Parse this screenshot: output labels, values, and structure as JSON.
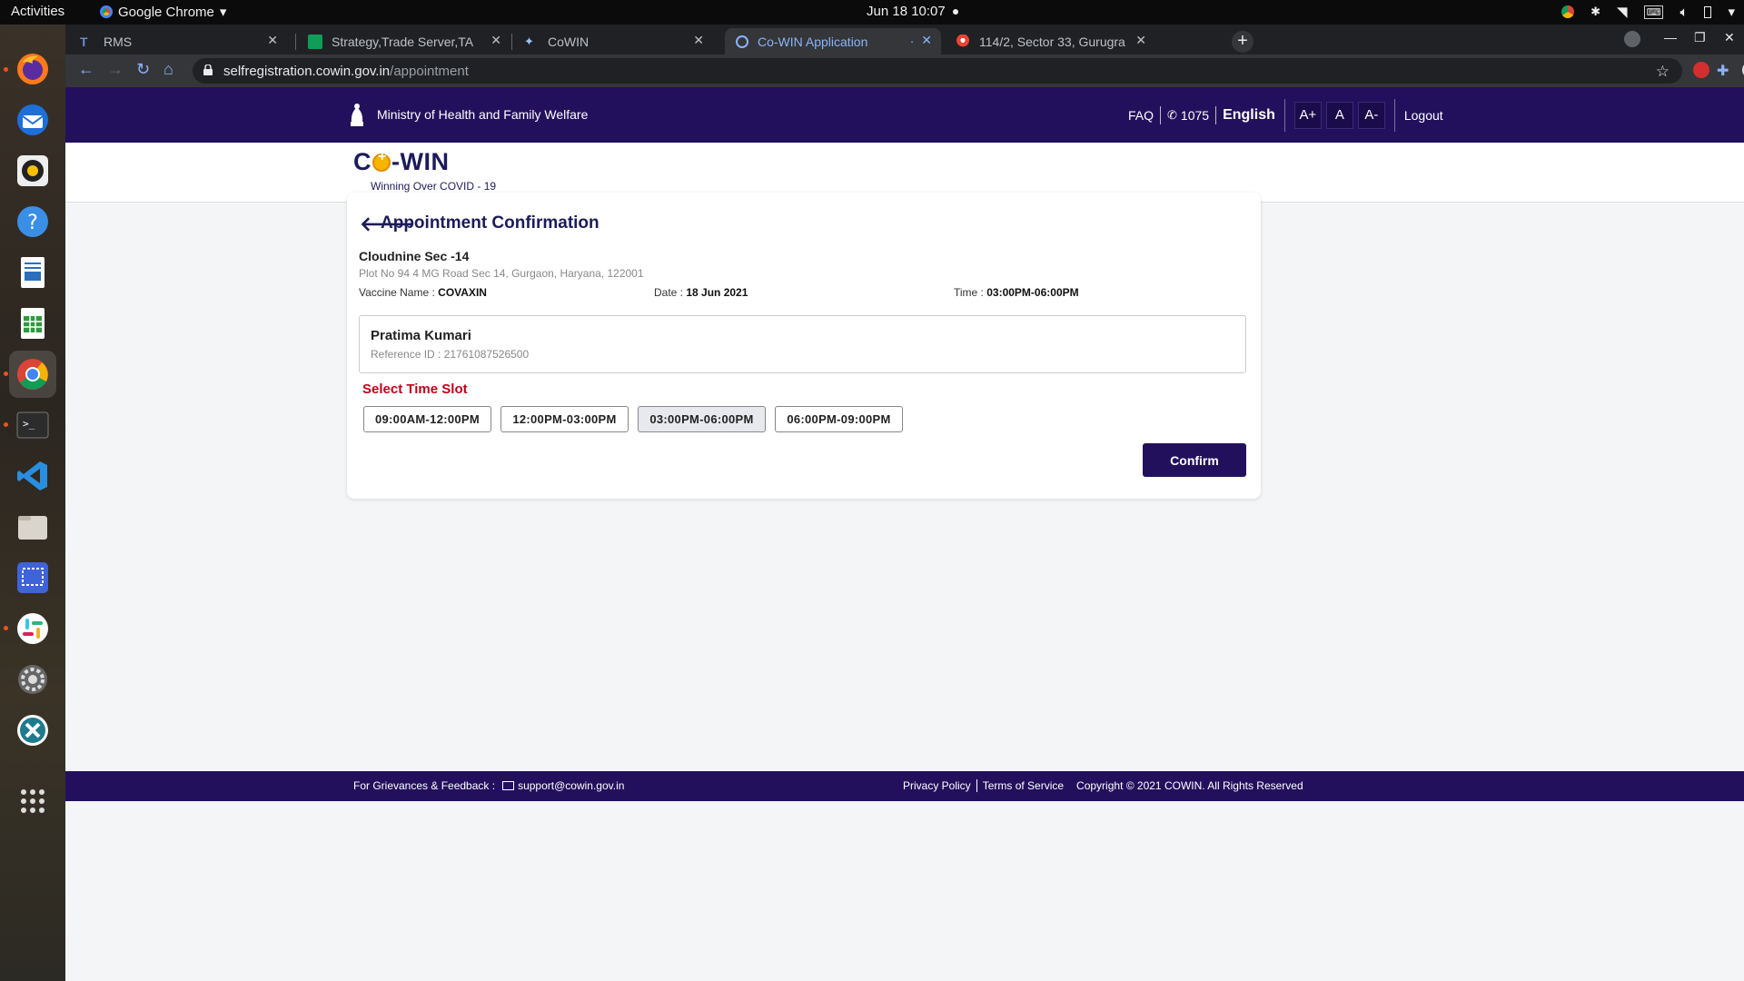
{
  "system": {
    "activities": "Activities",
    "app_name": "Google Chrome",
    "clock": "Jun 18  10:07"
  },
  "tabs": [
    {
      "label": "RMS",
      "active": false
    },
    {
      "label": "Strategy,Trade Server,TA",
      "active": false
    },
    {
      "label": "CoWIN",
      "active": false
    },
    {
      "label": "Co-WIN Application",
      "active": true
    },
    {
      "label": "114/2, Sector 33, Gurugra",
      "active": false
    }
  ],
  "url": {
    "host": "selfregistration.cowin.gov.in",
    "path": "/appointment"
  },
  "header": {
    "ministry": "Ministry of Health and Family Welfare",
    "faq": "FAQ",
    "helpline": "1075",
    "language": "English",
    "font_increase": "A+",
    "font_normal": "A",
    "font_decrease": "A-",
    "logout": "Logout"
  },
  "brand": {
    "logo_left": "C",
    "logo_right": "-WIN",
    "tagline": "Winning Over COVID - 19"
  },
  "appointment": {
    "title": "Appointment Confirmation",
    "center_name": "Cloudnine Sec -14",
    "center_address": "Plot No 94 4 MG Road Sec 14, Gurgaon, Haryana, 122001",
    "vaccine_label": "Vaccine Name :",
    "vaccine_value": "COVAXIN",
    "date_label": "Date :",
    "date_value": "18 Jun 2021",
    "time_label": "Time :",
    "time_value": "03:00PM-06:00PM",
    "beneficiary_name": "Pratima Kumari",
    "reference": "Reference ID : 21761087526500",
    "slot_title": "Select Time Slot",
    "slots": [
      "09:00AM-12:00PM",
      "12:00PM-03:00PM",
      "03:00PM-06:00PM",
      "06:00PM-09:00PM"
    ],
    "selected_slot": "03:00PM-06:00PM",
    "confirm_label": "Confirm"
  },
  "footer": {
    "grievance": "For Grievances & Feedback :",
    "email": "support@cowin.gov.in",
    "privacy": "Privacy Policy",
    "terms": "Terms of Service",
    "copyright": "Copyright © 2021 COWIN. All Rights Reserved"
  },
  "colors": {
    "brand_navy": "#23105d",
    "slot_title_red": "#c00018",
    "page_bg": "#f4f5f7"
  }
}
